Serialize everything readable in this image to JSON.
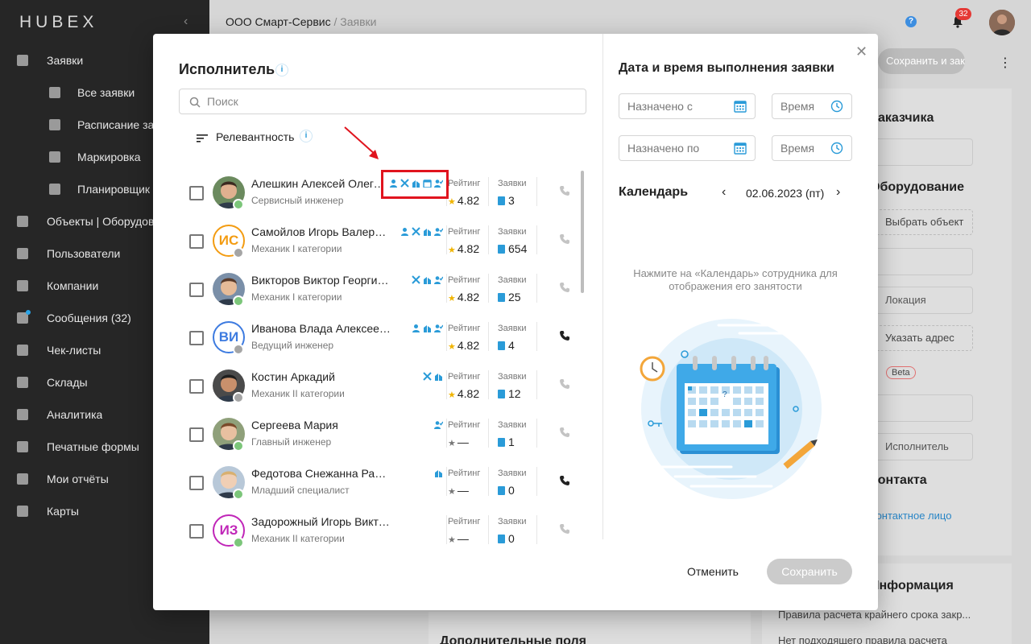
{
  "app": {
    "logo": "HUBEX"
  },
  "sidebar": {
    "items": [
      {
        "label": "Заявки",
        "icon": "clipboard-icon"
      },
      {
        "label": "Все заявки",
        "icon": "list-icon"
      },
      {
        "label": "Расписание заявок",
        "icon": "calendar-icon"
      },
      {
        "label": "Маркировка",
        "icon": "qr-icon"
      },
      {
        "label": "Планировщик работ",
        "icon": "timer-icon"
      },
      {
        "label": "Объекты | Оборудование",
        "icon": "wrench-icon"
      },
      {
        "label": "Пользователи",
        "icon": "users-icon"
      },
      {
        "label": "Компании",
        "icon": "briefcase-icon"
      },
      {
        "label": "Сообщения (32)",
        "icon": "message-icon"
      },
      {
        "label": "Чек-листы",
        "icon": "checklist-icon"
      },
      {
        "label": "Склады",
        "icon": "warehouse-icon"
      },
      {
        "label": "Аналитика",
        "icon": "pie-chart-icon"
      },
      {
        "label": "Печатные формы",
        "icon": "print-form-icon"
      },
      {
        "label": "Мои отчёты",
        "icon": "report-icon"
      },
      {
        "label": "Карты",
        "icon": "map-icon"
      }
    ]
  },
  "header": {
    "breadcrumb_company": "ООО Смарт-Сервис",
    "breadcrumb_sep": "/",
    "breadcrumb_current": "Заявки",
    "notification_count": "32"
  },
  "background": {
    "save_close_btn": "Сохранить и закрыть",
    "customer_title": "Заказчика",
    "equipment_title": "Оборудование",
    "choose_object": "Выбрать объект",
    "location_placeholder": "Локация",
    "choose_address": "Указать адрес",
    "beta": "Beta",
    "executor_placeholder": "Исполнитель",
    "section_title": "Контакта",
    "contact_link": "Контактное лицо",
    "info_title": "Информация",
    "rules_text": "Правила расчета крайнего срока закр...",
    "no_rule_text": "Нет подходящего правила расчета",
    "extra_fields": "Дополнительные поля"
  },
  "modal": {
    "title": "Исполнитель",
    "search_placeholder": "Поиск",
    "sort_label": "Релевантность",
    "rating_label": "Рейтинг",
    "orders_label": "Заявки",
    "colors": {
      "accent": "#2a9bd8",
      "highlight": "#e0141e"
    },
    "rows": [
      {
        "name": "Алешкин Алексей Олегович",
        "role": "Сервисный инженер",
        "rating": "4.82",
        "orders": "3",
        "online": true,
        "avatar": "photo",
        "initials": "",
        "badges": [
          "user-icon",
          "tools-icon",
          "building-icon",
          "calendar-icon",
          "user-check-icon"
        ],
        "phone_active": false
      },
      {
        "name": "Самойлов Игорь Валерьевич",
        "role": "Механик I категории",
        "rating": "4.82",
        "orders": "654",
        "online": false,
        "avatar": "initials",
        "initials": "ИС",
        "initials_color": "#f39c12",
        "badges": [
          "user-icon",
          "tools-icon",
          "building-icon",
          "user-check-icon"
        ],
        "phone_active": false
      },
      {
        "name": "Викторов Виктор Георгиевич",
        "role": "Механик I категории",
        "rating": "4.82",
        "orders": "25",
        "online": true,
        "avatar": "photo",
        "initials": "",
        "badges": [
          "tools-icon",
          "building-icon",
          "user-check-icon"
        ],
        "phone_active": false
      },
      {
        "name": "Иванова Влада Алексеевна",
        "role": "Ведущий инженер",
        "rating": "4.82",
        "orders": "4",
        "online": false,
        "avatar": "initials",
        "initials": "ВИ",
        "initials_color": "#3d7be0",
        "badges": [
          "user-icon",
          "building-icon",
          "user-check-icon"
        ],
        "phone_active": true
      },
      {
        "name": "Костин Аркадий",
        "role": "Механик II категории",
        "rating": "4.82",
        "orders": "12",
        "online": false,
        "avatar": "photo",
        "initials": "",
        "badges": [
          "tools-icon",
          "building-icon"
        ],
        "phone_active": false
      },
      {
        "name": "Сергеева Мария",
        "role": "Главный инженер",
        "rating": "—",
        "orders": "1",
        "online": true,
        "avatar": "photo",
        "initials": "",
        "badges": [
          "user-check-icon"
        ],
        "phone_active": false
      },
      {
        "name": "Федотова Снежанна Рафаиловна",
        "role": "Младший специалист",
        "rating": "—",
        "orders": "0",
        "online": true,
        "avatar": "photo",
        "initials": "",
        "badges": [
          "building-icon"
        ],
        "phone_active": true
      },
      {
        "name": "Задорожный Игорь Викторович",
        "role": "Механик II категории",
        "rating": "—",
        "orders": "0",
        "online": true,
        "avatar": "initials",
        "initials": "ИЗ",
        "initials_color": "#c026b8",
        "badges": [],
        "phone_active": false
      }
    ],
    "right": {
      "title": "Дата и время выполнения заявки",
      "assigned_from": "Назначено с",
      "assigned_to": "Назначено по",
      "time1": "Время",
      "time2": "Время",
      "calendar_label": "Календарь",
      "date": "02.06.2023 (пт)",
      "hint": "Нажмите на «Календарь» сотрудника для отображения его занятости"
    },
    "cancel": "Отменить",
    "save": "Сохранить"
  }
}
